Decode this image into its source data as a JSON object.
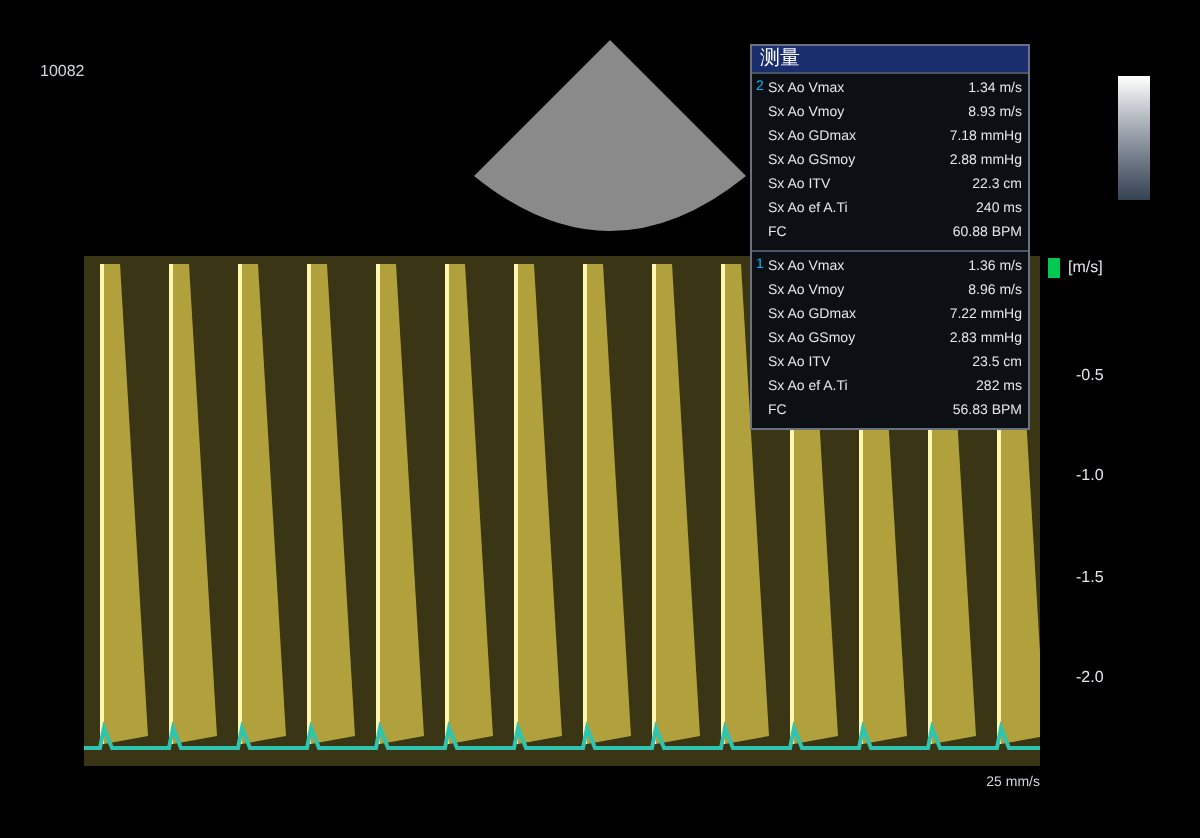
{
  "screen_label": "10082",
  "measurements": {
    "header": "测量",
    "groups": [
      {
        "marker": "2",
        "rows": [
          {
            "label": "Sx Ao Vmax",
            "value": "1.34 m/s"
          },
          {
            "label": "Sx Ao Vmoy",
            "value": "8.93 m/s"
          },
          {
            "label": "Sx Ao GDmax",
            "value": "7.18 mmHg"
          },
          {
            "label": "Sx Ao GSmoy",
            "value": "2.88 mmHg"
          },
          {
            "label": "Sx Ao ITV",
            "value": "22.3 cm"
          },
          {
            "label": "Sx Ao ef A.Ti",
            "value": "240 ms"
          },
          {
            "label": "FC",
            "value": "60.88 BPM"
          }
        ]
      },
      {
        "marker": "1",
        "rows": [
          {
            "label": "Sx Ao Vmax",
            "value": "1.36 m/s"
          },
          {
            "label": "Sx Ao Vmoy",
            "value": "8.96 m/s"
          },
          {
            "label": "Sx Ao GDmax",
            "value": "7.22 mmHg"
          },
          {
            "label": "Sx Ao GSmoy",
            "value": "2.83 mmHg"
          },
          {
            "label": "Sx Ao ITV",
            "value": "23.5 cm"
          },
          {
            "label": "Sx Ao ef A.Ti",
            "value": "282 ms"
          },
          {
            "label": "FC",
            "value": "56.83 BPM"
          }
        ]
      }
    ]
  },
  "scale": {
    "unit": "[m/s]",
    "ticks": [
      "-0.5",
      "-1.0",
      "-1.5",
      "-2.0"
    ]
  },
  "sweep_speed": "25 mm/s"
}
